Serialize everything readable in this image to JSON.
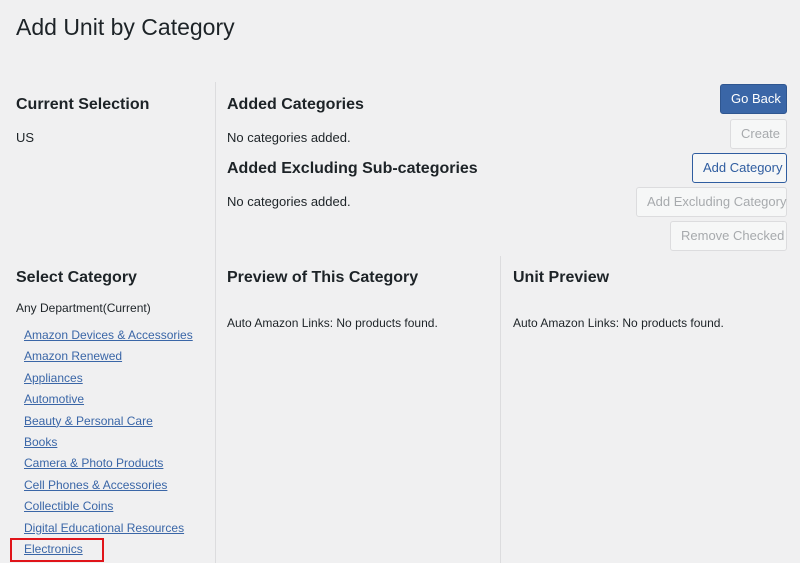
{
  "page": {
    "title": "Add Unit by Category"
  },
  "current_selection": {
    "heading": "Current Selection",
    "value": "US"
  },
  "added_categories": {
    "heading": "Added Categories",
    "empty_text": "No categories added."
  },
  "added_excluding": {
    "heading": "Added Excluding Sub-categories",
    "empty_text": "No categories added."
  },
  "buttons": {
    "go_back": "Go Back",
    "create": "Create",
    "add_category": "Add Category",
    "add_excluding": "Add Excluding Category",
    "remove_checked": "Remove Checked"
  },
  "select_category": {
    "heading": "Select Category",
    "current": "Any Department(Current)",
    "items": [
      "Amazon Devices & Accessories",
      "Amazon Renewed",
      "Appliances",
      "Automotive",
      "Beauty & Personal Care",
      "Books",
      "Camera & Photo Products",
      "Cell Phones & Accessories",
      "Collectible Coins",
      "Digital Educational Resources",
      "Electronics"
    ]
  },
  "preview_category": {
    "heading": "Preview of This Category",
    "message": "Auto Amazon Links: No products found."
  },
  "unit_preview": {
    "heading": "Unit Preview",
    "message": "Auto Amazon Links: No products found."
  },
  "colors": {
    "primary": "#3a66a7",
    "link": "#3a66a7",
    "highlight": "#e0141a",
    "background": "#f0f0f1"
  }
}
